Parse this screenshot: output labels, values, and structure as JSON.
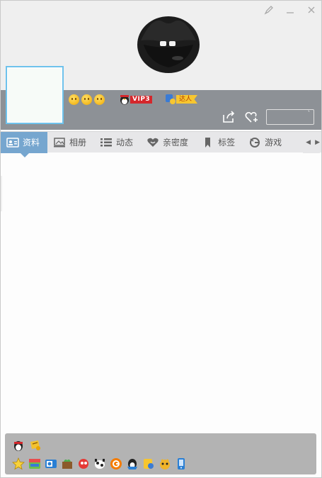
{
  "window": {
    "controls": [
      {
        "name": "skin-icon",
        "glyph": "✎"
      },
      {
        "name": "minimize-icon",
        "glyph": "—"
      },
      {
        "name": "close-icon",
        "glyph": "✕"
      }
    ]
  },
  "profile": {
    "vip_label": "VIP3",
    "daren_label": "达人"
  },
  "tabs": [
    {
      "label": "资料",
      "icon": "profile-card-icon",
      "active": true
    },
    {
      "label": "相册",
      "icon": "photo-album-icon",
      "active": false
    },
    {
      "label": "动态",
      "icon": "list-icon",
      "active": false
    },
    {
      "label": "亲密度",
      "icon": "heart-icon",
      "active": false
    },
    {
      "label": "标签",
      "icon": "bookmark-icon",
      "active": false
    },
    {
      "label": "游戏",
      "icon": "game-icon",
      "active": false
    }
  ],
  "tab_nav": {
    "prev": "◀",
    "next": "▶"
  },
  "actions": {
    "box_text": "`"
  },
  "colors": {
    "accent": "#76a6cf",
    "graybar": "#8d9196",
    "vip_red": "#d4272c",
    "daren_yellow": "#f7c62f"
  }
}
